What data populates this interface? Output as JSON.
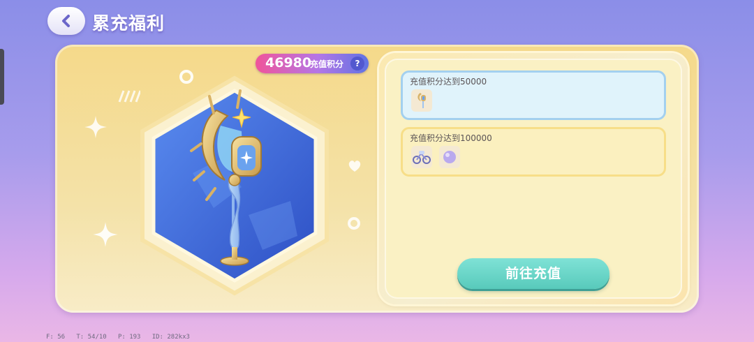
{
  "header": {
    "title": "累充福利",
    "back_icon": "chevron-left-icon"
  },
  "score": {
    "value": "46980",
    "label": "充值积分",
    "help": "?"
  },
  "rewards": [
    {
      "label": "充值积分达到50000",
      "items": [
        "magic-staff-item-icon"
      ],
      "state": "current",
      "accent": "#a3d0ef"
    },
    {
      "label": "充值积分达到100000",
      "items": [
        "toy-bike-item-icon",
        "purple-orb-item-icon"
      ],
      "state": "locked",
      "accent": "#f7de88"
    }
  ],
  "cta": {
    "label": "前往充值",
    "color": "#5fcfc0"
  },
  "debug": {
    "text": "F: 56   T: 54/10   P: 193   ID: 282kx3"
  },
  "colors": {
    "panel": "#f5d98a",
    "pill_start": "#f0549a",
    "pill_end": "#5f73e3",
    "hex": "#3f6bd8"
  }
}
